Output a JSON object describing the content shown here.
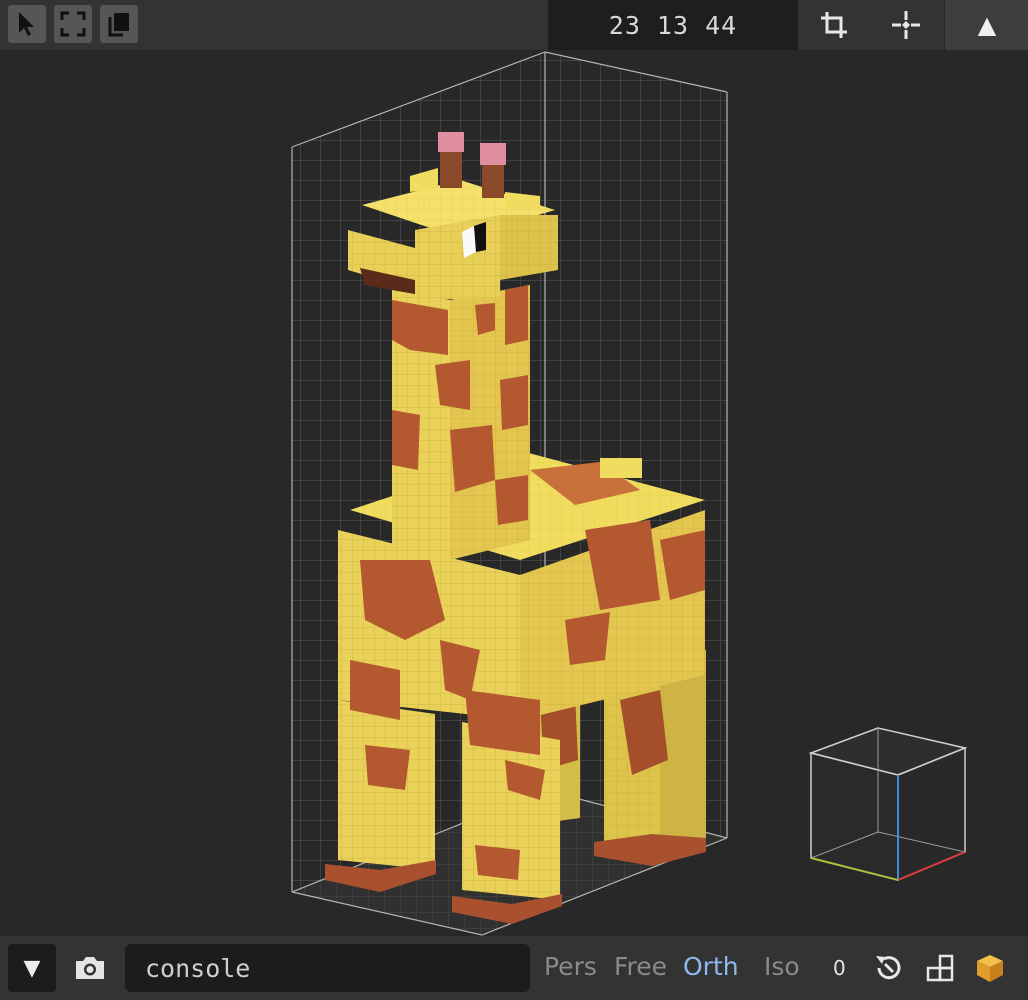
{
  "toolbar": {
    "tools": [
      {
        "name": "select-tool",
        "icon": "cursor-arrow-icon"
      },
      {
        "name": "marquee-tool",
        "icon": "selection-frame-icon"
      },
      {
        "name": "copy-tool",
        "icon": "copy-pages-icon"
      }
    ],
    "dimensions": "23 13 44",
    "actions": [
      {
        "name": "crop-button",
        "icon": "crop-icon"
      },
      {
        "name": "center-button",
        "icon": "move-center-icon"
      }
    ],
    "expand_icon": "triangle-up-icon",
    "expand_label": "▲"
  },
  "viewport": {
    "model": "giraffe",
    "colors": {
      "background": "#282828",
      "yellow": "#eed957",
      "spot": "#b3582f",
      "hoof": "#b85a38",
      "horn_tip": "#e08fa3",
      "grid_line": "#a9a9a9"
    }
  },
  "bottom": {
    "collapse_label": "▼",
    "camera_icon": "camera-icon",
    "console_placeholder": "console",
    "view_modes": [
      {
        "label": "Pers",
        "active": false
      },
      {
        "label": "Free",
        "active": false
      },
      {
        "label": "Orth",
        "active": true
      },
      {
        "label": "Iso",
        "active": false
      }
    ],
    "counter": "0",
    "icons": [
      "reset-view-icon",
      "layout-blocks-icon",
      "voxel-cube-icon"
    ],
    "accent": "#8fb8ee"
  }
}
